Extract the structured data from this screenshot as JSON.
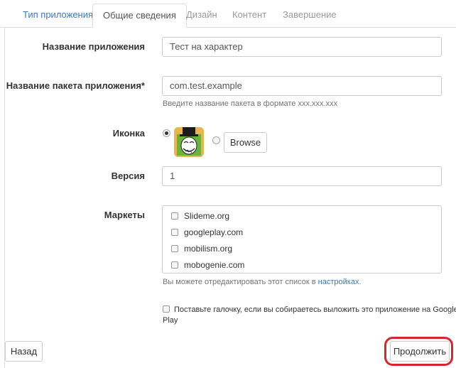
{
  "tabs": [
    {
      "label": "Тип приложения",
      "state": "link"
    },
    {
      "label": "Общие сведения",
      "state": "active"
    },
    {
      "label": "Дизайн",
      "state": "disabled"
    },
    {
      "label": "Контент",
      "state": "disabled"
    },
    {
      "label": "Завершение",
      "state": "disabled"
    }
  ],
  "form": {
    "app_name_label": "Название приложения",
    "app_name_value": "Тест на характер",
    "package_label": "Название пакета приложения*",
    "package_value": "com.test.example",
    "package_help": "Введите название пакета в формате xxx.xxx.xxx",
    "icon_label": "Иконка",
    "browse_label": "Browse",
    "version_label": "Версия",
    "version_value": "1",
    "markets_label": "Маркеты",
    "markets": [
      "Slideme.org",
      "googleplay.com",
      "mobilism.org",
      "mobogenie.com"
    ],
    "markets_help_prefix": "Вы можете отредактировать этот список в",
    "markets_help_link": "настройках",
    "markets_help_suffix": ".",
    "google_play_line1": "Поставьте галочку, если вы собираетесь выложить это приложение на Google",
    "google_play_line2": "Play"
  },
  "buttons": {
    "back_label": "Назад",
    "continue_label": "Продолжить"
  },
  "colors": {
    "link": "#3a7abf",
    "highlight": "#d8252e",
    "border": "#cccccc"
  }
}
